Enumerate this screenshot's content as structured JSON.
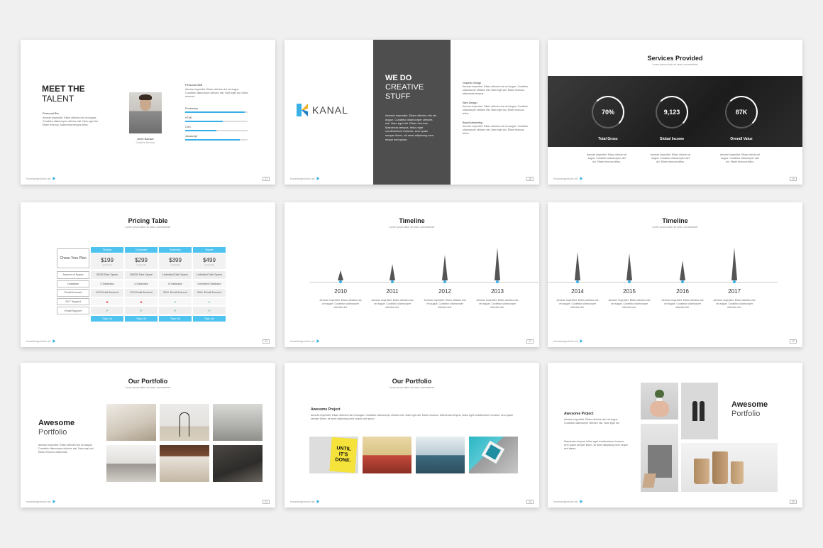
{
  "footer_url": "Kanaldesignstudio.net",
  "slides": {
    "s1": {
      "title_line1": "MEET THE",
      "title_line2": "TALENT",
      "bio_heading": "Personal Bio",
      "bio_text": "Aenean imperdiet. Etiam ultricies nisi vel augue. Curabitur ullamcorper ultricies nisi. Nam eget dui. Etiam rhoncus. Maecenas tempus tellus.",
      "name": "Anne Baluwe",
      "role": "Creative Director",
      "skill_heading": "Personal Skill",
      "skill_text": "Aenean imperdiet. Etiam ultricies nisi vel augue. Curabitur ullamcorper ultricies nisi. Nam eget dui. Etiam rhoncus.",
      "skills": [
        {
          "label": "Photoshop",
          "level": 0.95
        },
        {
          "label": "HTML",
          "level": 0.6
        },
        {
          "label": "CSS",
          "level": 0.5
        },
        {
          "label": "Javascript",
          "level": 0.88
        }
      ],
      "page": "17"
    },
    "s2": {
      "logo_text": "KANAL",
      "headline_1": "WE DO",
      "headline_2": "CREATIVE",
      "headline_3": "STUFF",
      "body": "Aenean imperdiet. Etiam ultricies nisi vel augue. Curabitur ullamcorper ultricies nisi. Nam eget dui. Etiam rhoncus. Maecenas tempus, tellus eget condimentum rhoncus, sem quam semper libero, sit amet adipiscing sem neque sed ipsum.",
      "services": [
        {
          "heading": "Graphic Design",
          "text": "Aenean imperdiet. Etiam ultricies nisi vel augue. Curabitur ullamcorper ultricies nisi. Nam eget dui. Etiam rhoncus. Maecenas tempus."
        },
        {
          "heading": "Web Design",
          "text": "Aenean imperdiet. Etiam ultricies nisi vel augue. Curabitur ullamcorper ultricies nisi. Nam eget dui. Etiam rhoncus tellus."
        },
        {
          "heading": "Brand Marketing",
          "text": "Aenean imperdiet. Etiam ultricies nisi vel augue. Curabitur ullamcorper ultricies nisi. Nam eget dui. Etiam rhoncus tellus."
        }
      ],
      "page": "18"
    },
    "s3": {
      "title": "Services Provided",
      "subtitle": "Lorem ipsum dolor sit amet, consectetuer",
      "stats": [
        {
          "value": "70%",
          "label": "Total Gross"
        },
        {
          "value": "9,123",
          "label": "Global Income"
        },
        {
          "value": "87K",
          "label": "Overall Value"
        }
      ],
      "stat_text": "Aenean imperdiet. Etiam ultricie vel augue. Curabitur ullamcorper ultri dui. Etiam rhoncus tellus.",
      "page": "19"
    },
    "s4": {
      "title": "Pricing Table",
      "subtitle": "Lorem ipsum dolor sit amet, consectetuer",
      "corner": "Chose Your Plan",
      "rows": [
        "Amount of Space",
        "Database",
        "Email Account",
        "24/7 Support",
        "Email Support"
      ],
      "plans": [
        {
          "name": "Startup",
          "price": "$199",
          "per": "permonth",
          "values": [
            "50GB Disk Space",
            "2 Database",
            "100 Email Account"
          ],
          "support": [
            "x",
            "check"
          ]
        },
        {
          "name": "Corporate",
          "price": "$299",
          "per": "permonth",
          "values": [
            "250GB Disk Space",
            "4 Database",
            "100 Email Account"
          ],
          "support": [
            "x",
            "check"
          ]
        },
        {
          "name": "Business",
          "price": "$399",
          "per": "permonth",
          "values": [
            "Unlimited Disk Space",
            "8 Database",
            "900+ Email Account"
          ],
          "support": [
            "check",
            "check"
          ]
        },
        {
          "name": "Expert",
          "price": "$499",
          "per": "permonth",
          "values": [
            "Unlimited Disk Space",
            "Unlimited Database",
            "900+ Email Account"
          ],
          "support": [
            "check",
            "check"
          ]
        }
      ],
      "signup": "Sign Up",
      "page": "20"
    },
    "s5": {
      "title": "Timeline",
      "subtitle": "Lorem ipsum dolor sit amet, consectetuer",
      "items": [
        {
          "year": "2010",
          "level": 0.3
        },
        {
          "year": "2011",
          "level": 0.5
        },
        {
          "year": "2012",
          "level": 0.78
        },
        {
          "year": "2013",
          "level": 1.0
        }
      ],
      "text": "Aenean imperdiet. Etiam ultricies nisi vel augue. Curabitur ullamcorper ultricies nisi.",
      "page": "21"
    },
    "s6": {
      "title": "Timeline",
      "subtitle": "Lorem ipsum dolor sit amet, consectetuer",
      "items": [
        {
          "year": "2014",
          "level": 0.88
        },
        {
          "year": "2015",
          "level": 0.82
        },
        {
          "year": "2016",
          "level": 0.6
        },
        {
          "year": "2017",
          "level": 1.0
        }
      ],
      "text": "Aenean imperdiet. Etiam ultricies nisi vel augue. Curabitur ullamcorper ultricies nisi.",
      "page": "22"
    },
    "s7": {
      "title": "Our Portfolio",
      "subtitle": "Lorem ipsum dolor sit amet, consectetuer",
      "heading_1": "Awesome",
      "heading_2": "Portfolio",
      "text": "Aenean imperdiet. Etiam ultricies nisi vel augue. Curabitur ullamcorper ultricies nisi. Nam eget dui. Etiam rhoncus maecenas",
      "page": "23"
    },
    "s8": {
      "title": "Our Portfolio",
      "subtitle": "Lorem ipsum dolor sit amet, consectetuer",
      "heading": "Awesome Project",
      "text": "Aenean imperdiet. Etiam ultricies nisi vel augue. Curabitur ullamcorper ultricies nisi. Nam eget dui. Etiam rhoncus. Maecenas tempus, tellus eget condimentum rhoncus, sem quam semper libero, sit amet adipiscing sem neque sed ipsum.",
      "poster_text": "UNTIL IT'S DONE.",
      "page": "24"
    },
    "s9": {
      "heading": "Awesome Project",
      "text_1": "Aenean imperdiet. Etiam ultricies nisi vel augue. Curabitur ullamcorper ultricies nisi. Nam eget dui.",
      "text_2": "Maecenas tempus, tellus eget condimentum rhoncus, sem quam semper libero, sit amet adipiscing sem neque sed ipsum.",
      "title_1": "Awesome",
      "title_2": "Portfolio",
      "page": "25"
    }
  },
  "colors": {
    "accent": "#3ab0e8",
    "dark": "#4e4e4e",
    "spike": "#555555"
  }
}
